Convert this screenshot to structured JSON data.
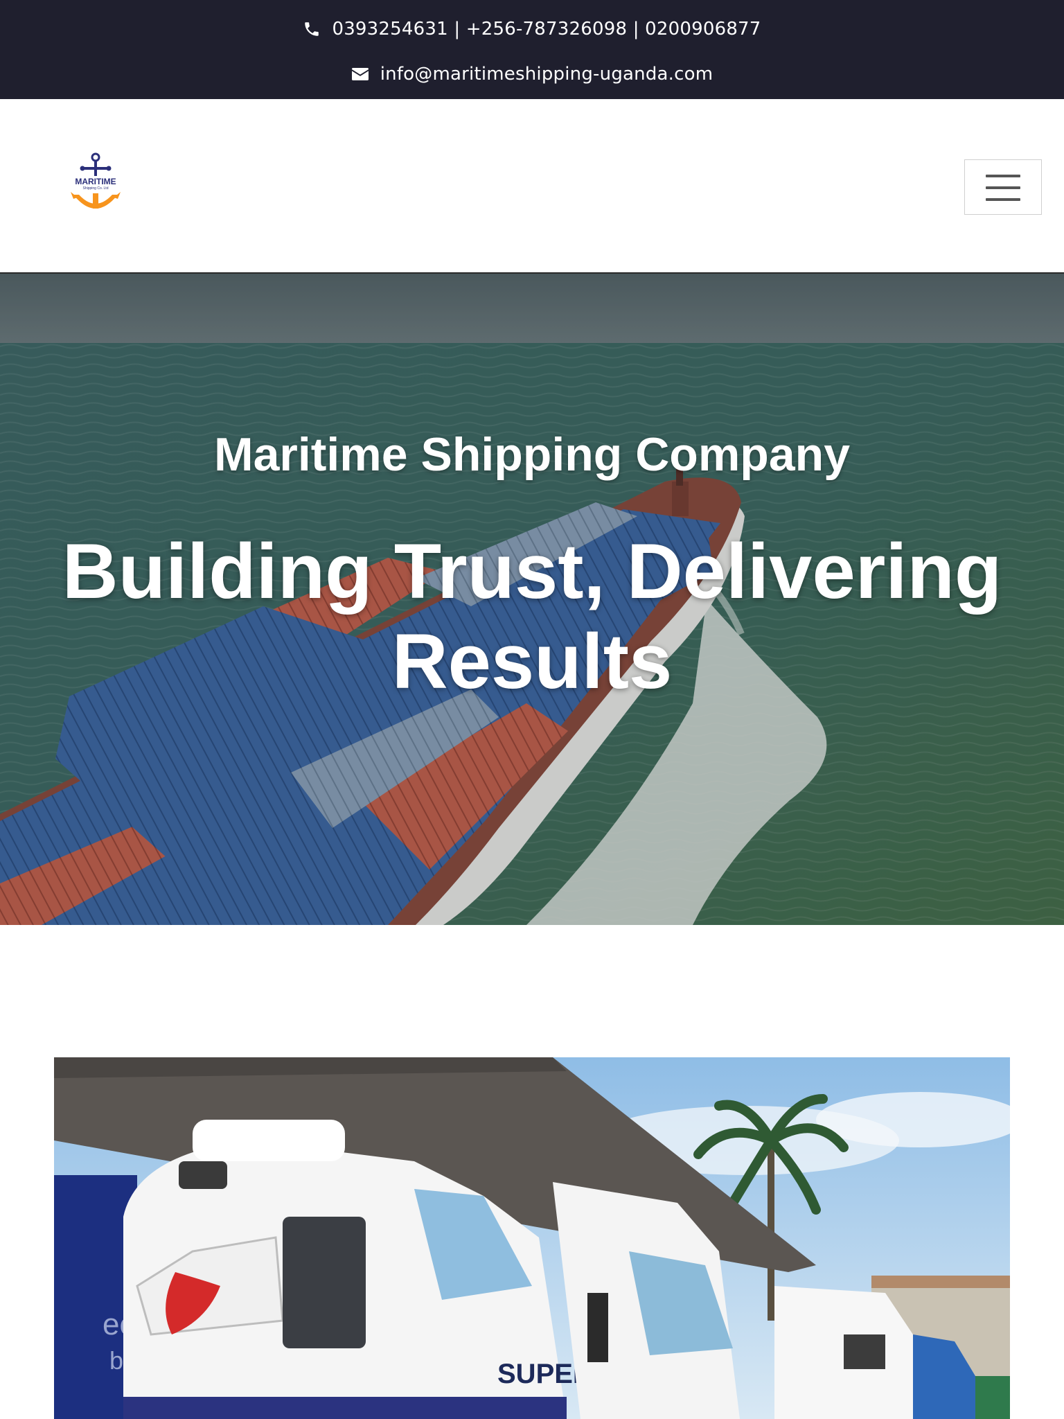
{
  "contact": {
    "phone_icon": "phone-icon",
    "phones": "0393254631 | +256-787326098 | 0200906877",
    "email_icon": "envelope-icon",
    "email": "info@maritimeshipping-uganda.com"
  },
  "header": {
    "logo": {
      "icon": "anchor-logo",
      "text": "MARITIME",
      "subtext": "Shipping Co. Ltd"
    },
    "menu_icon": "hamburger-icon"
  },
  "hero": {
    "subtitle": "Maritime Shipping Company",
    "title_line1": "Building Trust, Delivering",
    "title_line2": "Results",
    "image": "container-ship-at-sea"
  },
  "photo": {
    "image": "trucks-at-depot",
    "truck_lettering": "SUPER S"
  },
  "colors": {
    "topbar_bg": "#1f1f2e",
    "logo_navy": "#2b2f7a",
    "logo_orange": "#f7941d",
    "text_white": "#ffffff"
  }
}
